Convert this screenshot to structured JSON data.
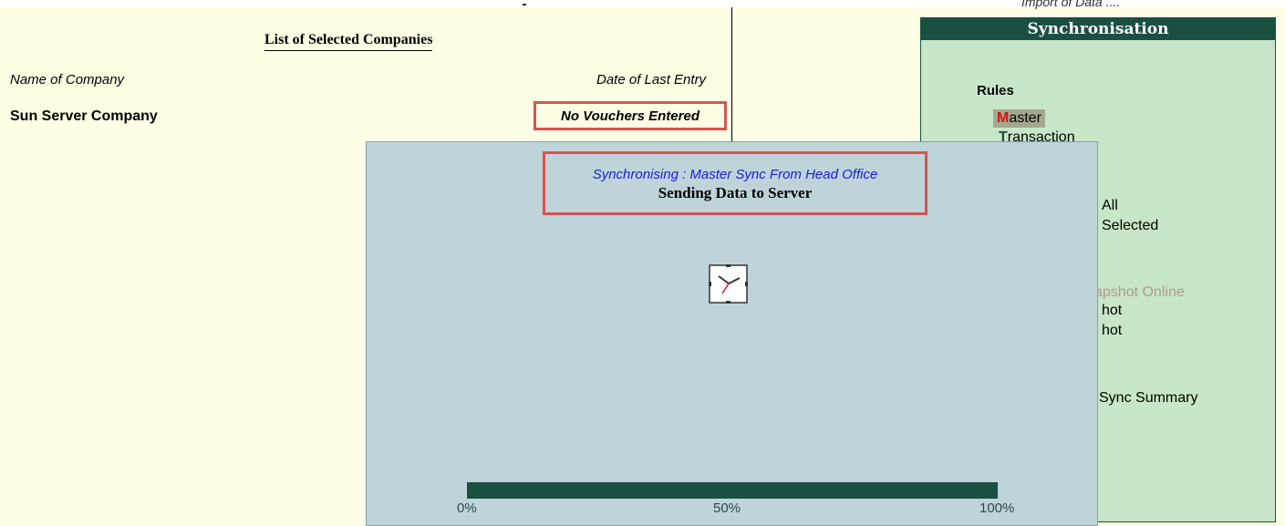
{
  "header": {
    "import_label": "Import of Data ...."
  },
  "companies": {
    "title": "List of Selected Companies",
    "col_name": "Name of Company",
    "col_date": "Date of Last Entry",
    "rows": [
      {
        "name": "Sun Server Company",
        "date": "No Vouchers Entered"
      }
    ]
  },
  "sync_panel": {
    "title": "Synchronisation",
    "rules_label": "Rules",
    "menu": [
      {
        "hotkey": "M",
        "rest": "aster"
      },
      {
        "hotkey": "T",
        "rest": "ransaction"
      }
    ],
    "partial_items": {
      "all": "All",
      "selected": "Selected",
      "snapshot_online": "apshot Online",
      "snapshot_1": "hot",
      "snapshot_2": "hot",
      "sync_summary": "Sync Summary"
    }
  },
  "dialog": {
    "status_line": "Synchronising : Master Sync From Head Office",
    "message": "Sending Data to Server",
    "progress_fraction": 1.0,
    "progress_labels": [
      "0%",
      "50%",
      "100%"
    ]
  },
  "colors": {
    "accent_dark_green": "#1b5040",
    "highlight_red": "#d9534f",
    "hotkey_red": "#e01010",
    "status_blue": "#1a1ae6"
  }
}
